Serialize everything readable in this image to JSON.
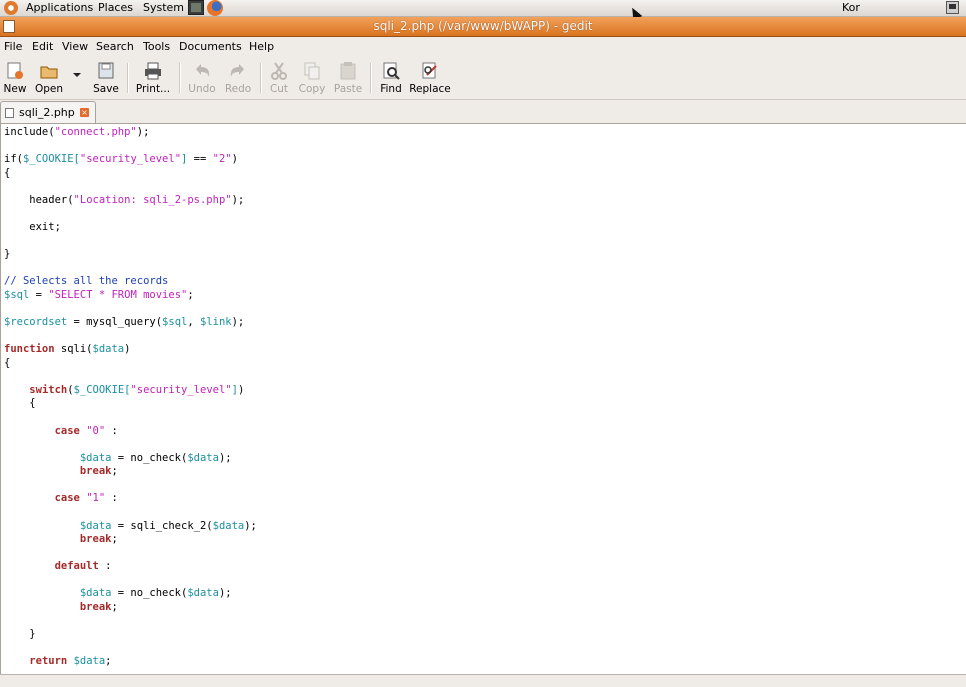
{
  "panel": {
    "applications": "Applications",
    "places": "Places",
    "system": "System",
    "keyboard_layout": "Kor"
  },
  "window": {
    "title": "sqli_2.php (/var/www/bWAPP) - gedit"
  },
  "menubar": {
    "items": [
      "File",
      "Edit",
      "View",
      "Search",
      "Tools",
      "Documents",
      "Help"
    ]
  },
  "toolbar": {
    "new": "New",
    "open": "Open",
    "save": "Save",
    "print": "Print...",
    "undo": "Undo",
    "redo": "Redo",
    "cut": "Cut",
    "copy": "Copy",
    "paste": "Paste",
    "find": "Find",
    "replace": "Replace"
  },
  "tab": {
    "filename": "sqli_2.php"
  },
  "colors": {
    "titlebar_accent": "#d9731f",
    "string": "#c221ba",
    "variable": "#1a8fa0",
    "keyword": "#a52a2a",
    "comment": "#1c3fb8"
  },
  "code": [
    [
      {
        "t": "include("
      },
      {
        "t": "\"connect.php\"",
        "c": "str"
      },
      {
        "t": ");"
      }
    ],
    [],
    [
      {
        "t": "if("
      },
      {
        "t": "$_COOKIE[",
        "c": "var"
      },
      {
        "t": "\"security_level\"",
        "c": "str"
      },
      {
        "t": "]",
        "c": "var"
      },
      {
        "t": " == "
      },
      {
        "t": "\"2\"",
        "c": "str"
      },
      {
        "t": ")"
      }
    ],
    [
      {
        "t": "{"
      }
    ],
    [],
    [
      {
        "t": "    header("
      },
      {
        "t": "\"Location: sqli_2-ps.php\"",
        "c": "str"
      },
      {
        "t": ");"
      }
    ],
    [],
    [
      {
        "t": "    exit;"
      }
    ],
    [],
    [
      {
        "t": "}"
      }
    ],
    [],
    [
      {
        "t": "// Selects all the records",
        "c": "cmt"
      }
    ],
    [
      {
        "t": "$sql",
        "c": "var"
      },
      {
        "t": " = "
      },
      {
        "t": "\"SELECT * FROM movies\"",
        "c": "str"
      },
      {
        "t": ";"
      }
    ],
    [],
    [
      {
        "t": "$recordset",
        "c": "var"
      },
      {
        "t": " = mysql_query("
      },
      {
        "t": "$sql",
        "c": "var"
      },
      {
        "t": ", "
      },
      {
        "t": "$link",
        "c": "var"
      },
      {
        "t": ");"
      }
    ],
    [],
    [
      {
        "t": "function",
        "c": "kw"
      },
      {
        "t": " sqli("
      },
      {
        "t": "$data",
        "c": "var"
      },
      {
        "t": ")"
      }
    ],
    [
      {
        "t": "{"
      }
    ],
    [],
    [
      {
        "t": "    "
      },
      {
        "t": "switch",
        "c": "kw"
      },
      {
        "t": "("
      },
      {
        "t": "$_COOKIE[",
        "c": "var"
      },
      {
        "t": "\"security_level\"",
        "c": "str"
      },
      {
        "t": "]",
        "c": "var"
      },
      {
        "t": ")"
      }
    ],
    [
      {
        "t": "    {"
      }
    ],
    [],
    [
      {
        "t": "        "
      },
      {
        "t": "case",
        "c": "kw"
      },
      {
        "t": " "
      },
      {
        "t": "\"0\"",
        "c": "str"
      },
      {
        "t": " :"
      }
    ],
    [],
    [
      {
        "t": "            "
      },
      {
        "t": "$data",
        "c": "var"
      },
      {
        "t": " = no_check("
      },
      {
        "t": "$data",
        "c": "var"
      },
      {
        "t": ");"
      }
    ],
    [
      {
        "t": "            "
      },
      {
        "t": "break",
        "c": "kw"
      },
      {
        "t": ";"
      }
    ],
    [],
    [
      {
        "t": "        "
      },
      {
        "t": "case",
        "c": "kw"
      },
      {
        "t": " "
      },
      {
        "t": "\"1\"",
        "c": "str"
      },
      {
        "t": " :"
      }
    ],
    [],
    [
      {
        "t": "            "
      },
      {
        "t": "$data",
        "c": "var"
      },
      {
        "t": " = sqli_check_2("
      },
      {
        "t": "$data",
        "c": "var"
      },
      {
        "t": ");"
      }
    ],
    [
      {
        "t": "            "
      },
      {
        "t": "break",
        "c": "kw"
      },
      {
        "t": ";"
      }
    ],
    [],
    [
      {
        "t": "        "
      },
      {
        "t": "default",
        "c": "kw"
      },
      {
        "t": " :"
      }
    ],
    [],
    [
      {
        "t": "            "
      },
      {
        "t": "$data",
        "c": "var"
      },
      {
        "t": " = no_check("
      },
      {
        "t": "$data",
        "c": "var"
      },
      {
        "t": ");"
      }
    ],
    [
      {
        "t": "            "
      },
      {
        "t": "break",
        "c": "kw"
      },
      {
        "t": ";"
      }
    ],
    [],
    [
      {
        "t": "    }"
      }
    ],
    [],
    [
      {
        "t": "    "
      },
      {
        "t": "return",
        "c": "kw"
      },
      {
        "t": " "
      },
      {
        "t": "$data",
        "c": "var"
      },
      {
        "t": ";"
      }
    ]
  ]
}
